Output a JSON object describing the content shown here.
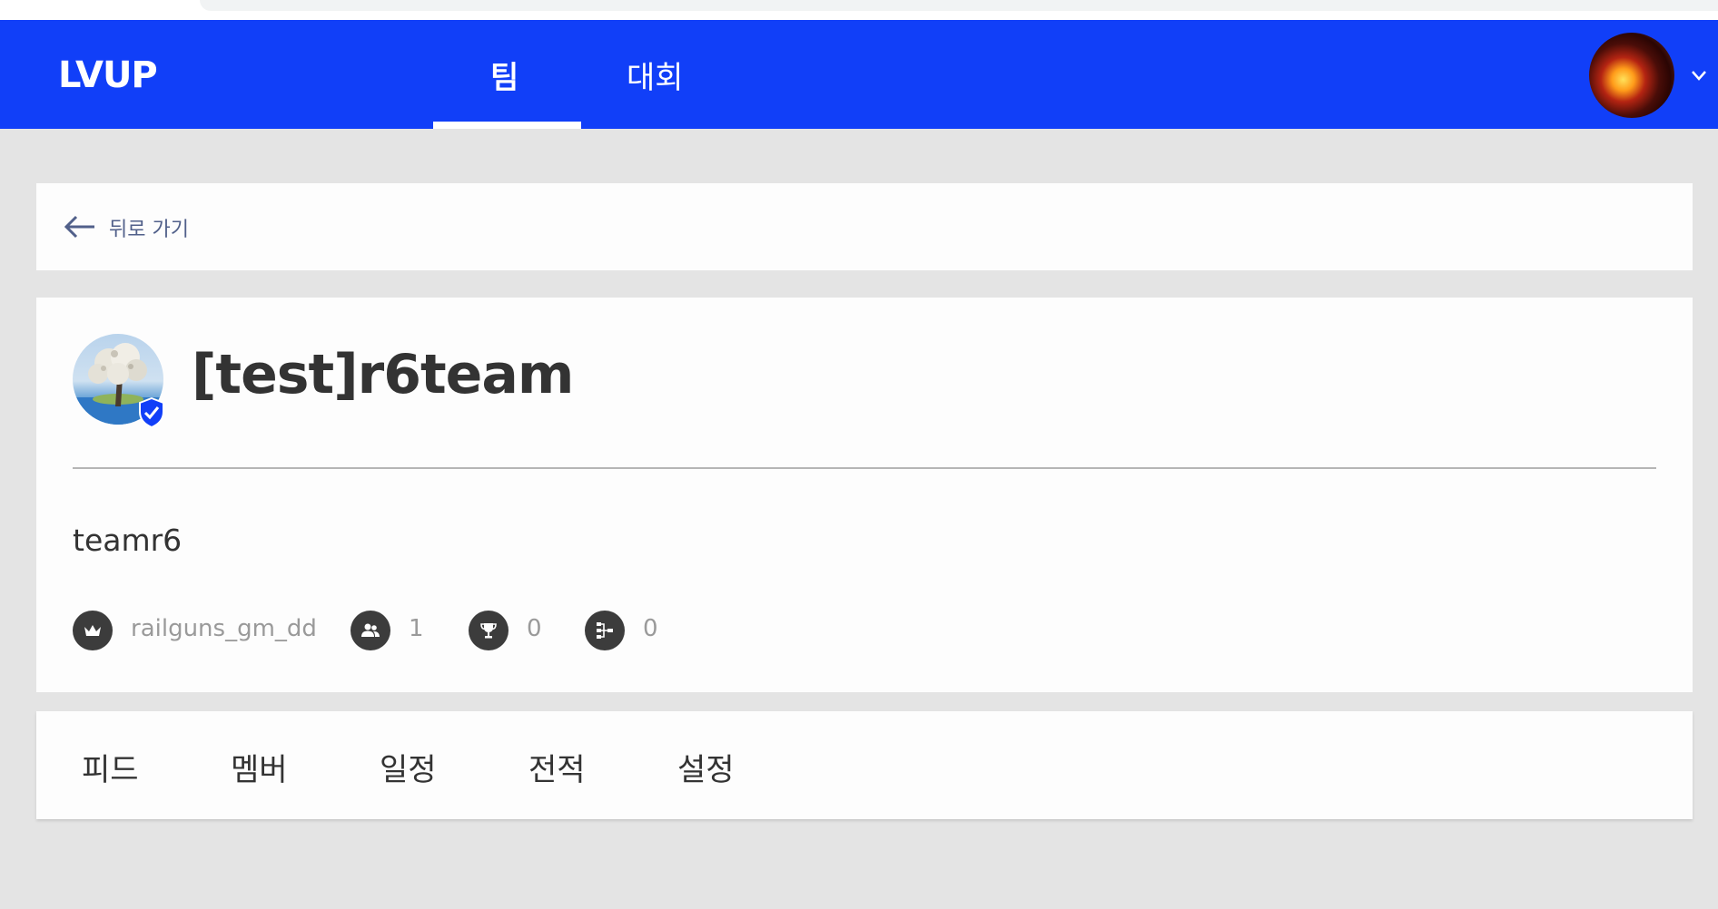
{
  "colors": {
    "brand": "#113ff8",
    "page_bg": "#e4e4e4",
    "card_bg": "#fdfdfd",
    "badge": "#113ff8"
  },
  "topnav": {
    "logo": "LVUP",
    "tabs": [
      {
        "label": "팀",
        "active": true
      },
      {
        "label": "대회",
        "active": false
      }
    ],
    "user_menu_icon": "chevron-down-icon"
  },
  "back": {
    "label": "뒤로 가기",
    "icon": "arrow-left-icon"
  },
  "team": {
    "name": "[test]r6team",
    "description": "teamr6",
    "verified_icon": "shield-check-icon",
    "stats": {
      "owner": {
        "icon": "crown-icon",
        "value": "railguns_gm_dd"
      },
      "members": {
        "icon": "people-icon",
        "value": "1"
      },
      "trophies": {
        "icon": "trophy-icon",
        "value": "0"
      },
      "brackets": {
        "icon": "bracket-icon",
        "value": "0"
      }
    }
  },
  "team_tabs": [
    "피드",
    "멤버",
    "일정",
    "전적",
    "설정"
  ]
}
